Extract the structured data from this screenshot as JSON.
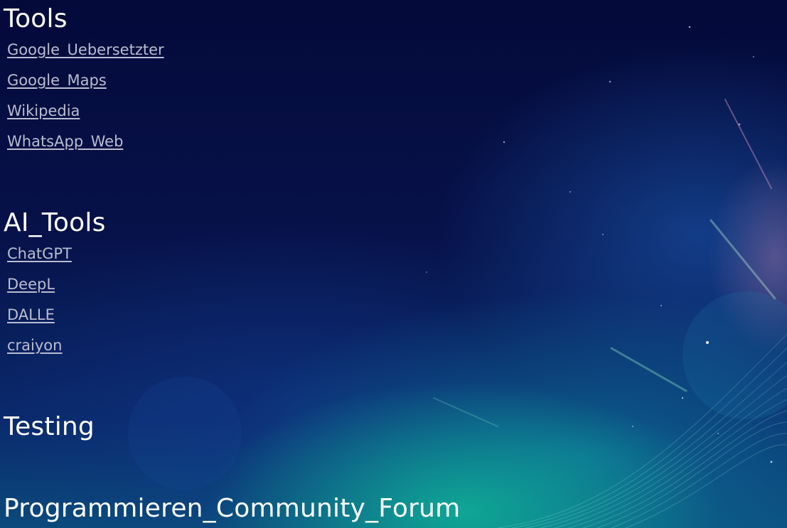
{
  "sections": [
    {
      "title": "Tools",
      "links": [
        "Google_Uebersetzter",
        "Google_Maps",
        "Wikipedia",
        "WhatsApp_Web"
      ]
    },
    {
      "title": "AI_Tools",
      "links": [
        "ChatGPT",
        "DeepL",
        "DALLE",
        "craiyon"
      ]
    },
    {
      "title": "Testing",
      "links": []
    },
    {
      "title": "Programmieren_Community_Forum",
      "links": []
    }
  ],
  "colors": {
    "background": "#030b3c",
    "heading": "#ffffff",
    "link": "#b9bdd0",
    "glow_green": "#12e6a0",
    "glow_pink": "#d27896"
  }
}
